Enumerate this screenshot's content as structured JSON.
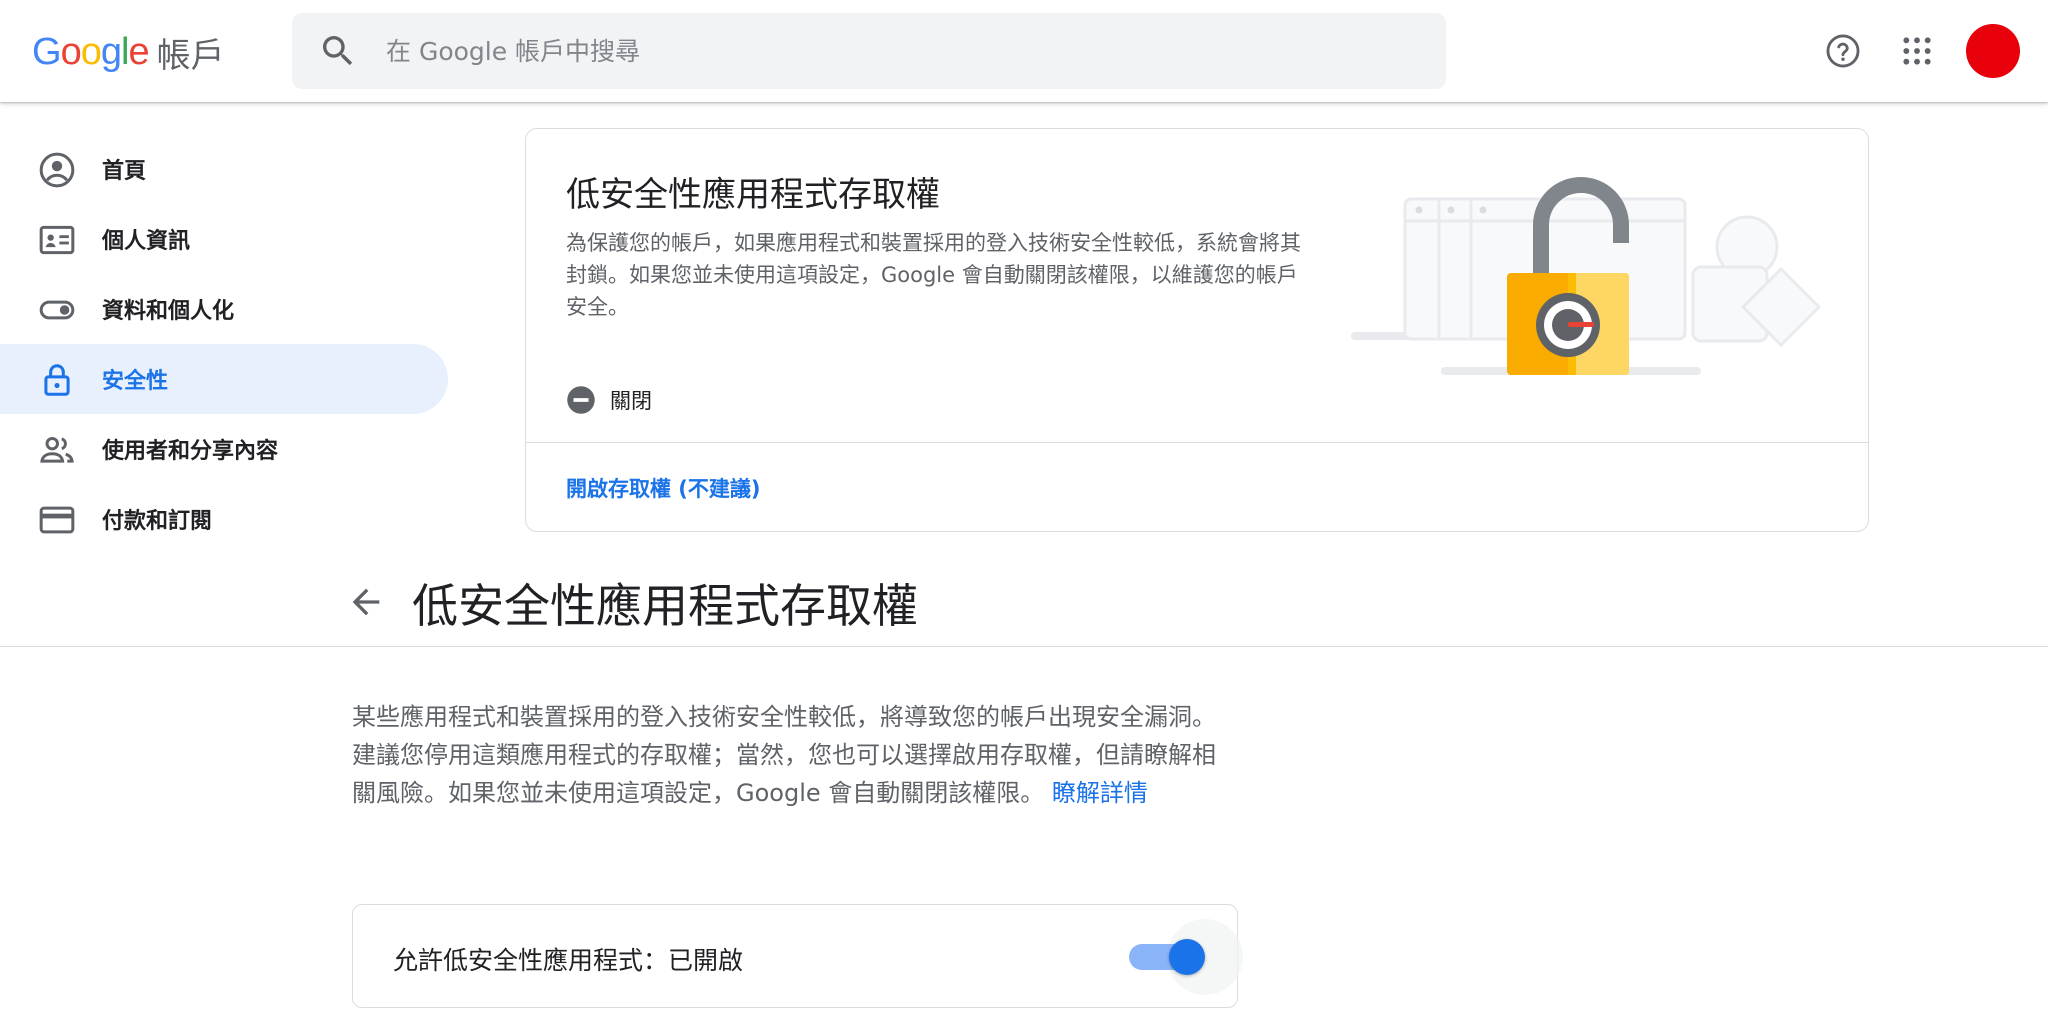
{
  "header": {
    "logo_letters": [
      "G",
      "o",
      "o",
      "g",
      "l",
      "e"
    ],
    "product": "帳戶",
    "search_placeholder": "在 Google 帳戶中搜尋",
    "avatar_color": "#e8000b"
  },
  "sidebar": {
    "items": [
      {
        "label": "首頁",
        "icon": "account-circle-icon"
      },
      {
        "label": "個人資訊",
        "icon": "id-card-icon"
      },
      {
        "label": "資料和個人化",
        "icon": "toggle-icon"
      },
      {
        "label": "安全性",
        "icon": "lock-icon",
        "active": true
      },
      {
        "label": "使用者和分享內容",
        "icon": "people-icon"
      },
      {
        "label": "付款和訂閱",
        "icon": "credit-card-icon"
      }
    ]
  },
  "card": {
    "title": "低安全性應用程式存取權",
    "description": "為保護您的帳戶，如果應用程式和裝置採用的登入技術安全性較低，系統會將其封鎖。如果您並未使用這項設定，Google 會自動關閉該權限，以維護您的帳戶安全。",
    "status": "關閉",
    "link": "開啟存取權 (不建議)"
  },
  "page": {
    "title": "低安全性應用程式存取權",
    "body": "某些應用程式和裝置採用的登入技術安全性較低，將導致您的帳戶出現安全漏洞。建議您停用這類應用程式的存取權；當然，您也可以選擇啟用存取權，但請瞭解相關風險。如果您並未使用這項設定，Google 會自動關閉該權限。",
    "learn_more": "瞭解詳情"
  },
  "toggle": {
    "label": "允許低安全性應用程式：已開啟",
    "on": true,
    "accent": "#1a73e8"
  }
}
